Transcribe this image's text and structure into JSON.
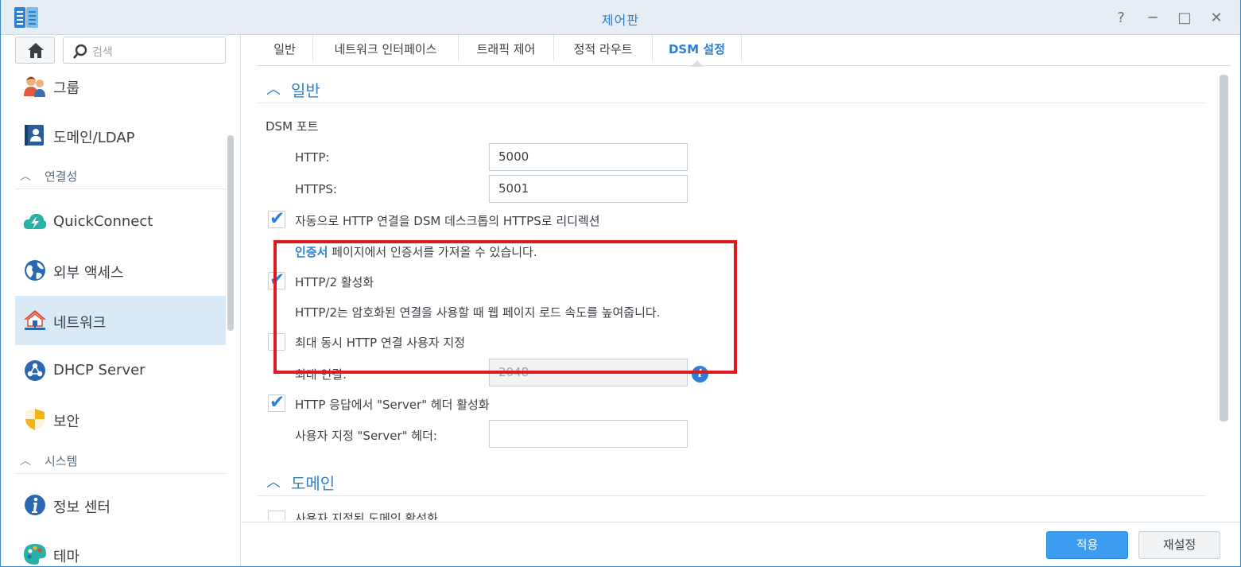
{
  "window": {
    "title": "제어판",
    "help_symbol": "?",
    "minimize_symbol": "─",
    "maximize_symbol": "□",
    "close_symbol": "✕"
  },
  "sidebar": {
    "search_placeholder": "검색",
    "items": [
      {
        "label": "그룹",
        "icon": "group-icon"
      },
      {
        "label": "도메인/LDAP",
        "icon": "domain-ldap-icon"
      },
      {
        "section": "연결성"
      },
      {
        "label": "QuickConnect",
        "icon": "quickconnect-icon"
      },
      {
        "label": "외부 액세스",
        "icon": "external-access-icon"
      },
      {
        "label": "네트워크",
        "icon": "network-icon",
        "active": true
      },
      {
        "label": "DHCP Server",
        "icon": "dhcp-server-icon"
      },
      {
        "label": "보안",
        "icon": "security-icon"
      },
      {
        "section": "시스템"
      },
      {
        "label": "정보 센터",
        "icon": "info-center-icon"
      },
      {
        "label": "테마",
        "icon": "theme-icon"
      }
    ]
  },
  "tabs": [
    {
      "label": "일반"
    },
    {
      "label": "네트워크 인터페이스"
    },
    {
      "label": "트래픽 제어"
    },
    {
      "label": "정적 라우트"
    },
    {
      "label": "DSM 설정",
      "active": true
    }
  ],
  "general": {
    "section_title": "일반",
    "dsm_port_label": "DSM 포트",
    "http_label": "HTTP:",
    "http_value": "5000",
    "https_label": "HTTPS:",
    "https_value": "5001",
    "redirect_https_label": "자동으로 HTTP 연결을 DSM 데스크톱의 HTTPS로 리디렉션",
    "redirect_https_checked": true,
    "certificate_link": "인증서",
    "certificate_note": " 페이지에서 인증서를 가져올 수 있습니다.",
    "http2_label": "HTTP/2 활성화",
    "http2_checked": true,
    "http2_note": "HTTP/2는 암호화된 연결을 사용할 때 웹 페이지 로드 속도를 높여줍니다.",
    "max_conn_custom_label": "최대 동시 HTTP 연결 사용자 지정",
    "max_conn_custom_checked": false,
    "max_conn_label": "최대 연결:",
    "max_conn_value": "2048",
    "server_header_label": "HTTP 응답에서 \"Server\" 헤더 활성화",
    "server_header_checked": true,
    "custom_server_header_label": "사용자 지정 \"Server\" 헤더:",
    "custom_server_header_value": ""
  },
  "domain": {
    "section_title": "도메인",
    "custom_domain_label": "사용자 지정된 도메인 활성화"
  },
  "footer": {
    "apply_label": "적용",
    "reset_label": "재설정"
  },
  "colors": {
    "accent": "#2f7fd0",
    "highlight": "#e0181f",
    "primary_button": "#3c9cef"
  }
}
